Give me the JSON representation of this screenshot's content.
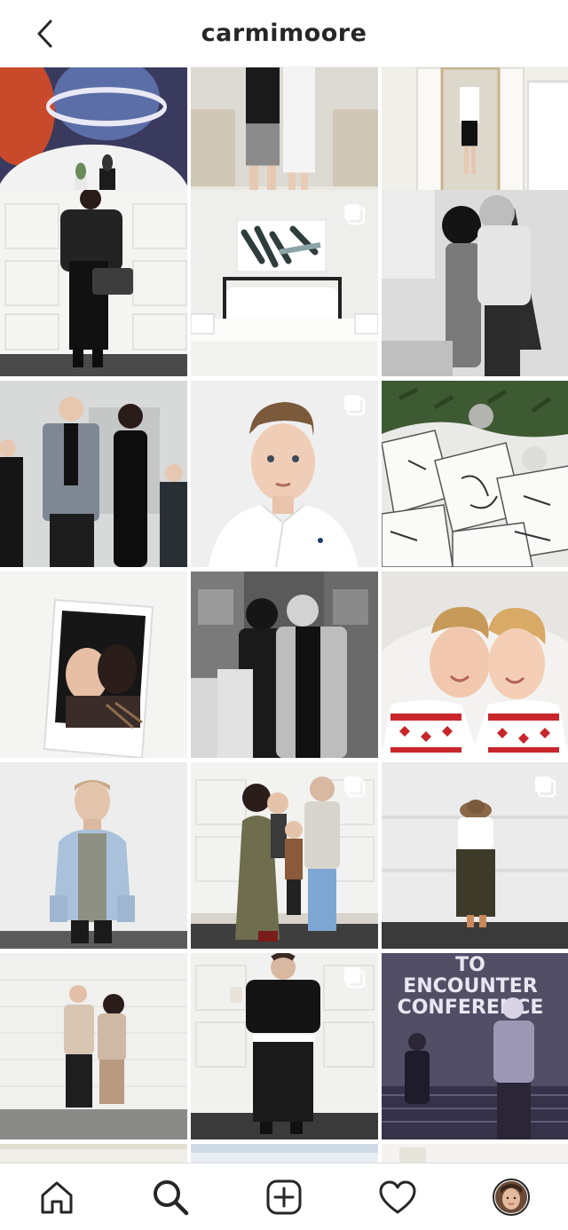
{
  "header": {
    "username": "carmimoore"
  },
  "colors": {
    "text": "#262626",
    "divider": "#dbdbdb"
  },
  "grid": {
    "tiles": [
      {
        "name": "kids-astronaut-scene",
        "multi": false
      },
      {
        "name": "couple-legs-stairs",
        "multi": false
      },
      {
        "name": "mirror-selfie-bathroom",
        "multi": false
      },
      {
        "name": "woman-leather-jacket",
        "multi": false
      },
      {
        "name": "bedroom-bed",
        "multi": true
      },
      {
        "name": "couple-christmas-kiss-bw",
        "multi": false
      },
      {
        "name": "family-portrait",
        "multi": false
      },
      {
        "name": "boy-white-shirt",
        "multi": true
      },
      {
        "name": "christmas-gifts-wrapped",
        "multi": false
      },
      {
        "name": "polaroid-couple",
        "multi": false
      },
      {
        "name": "couple-street-bw",
        "multi": false
      },
      {
        "name": "boys-christmas-pajamas",
        "multi": false
      },
      {
        "name": "boy-denim-jacket",
        "multi": false
      },
      {
        "name": "family-garage-door",
        "multi": true
      },
      {
        "name": "woman-hat-wall",
        "multi": true
      },
      {
        "name": "couple-white-wall",
        "multi": false
      },
      {
        "name": "woman-coffee-garage",
        "multi": true
      },
      {
        "name": "encounter-conference",
        "multi": false
      }
    ],
    "conference_text": [
      "TO",
      "ENCOUNTER",
      "CONFERENCE"
    ]
  },
  "bottom_nav": [
    {
      "name": "home-icon"
    },
    {
      "name": "search-icon"
    },
    {
      "name": "add-post-icon"
    },
    {
      "name": "activity-heart-icon"
    },
    {
      "name": "profile-avatar"
    }
  ]
}
